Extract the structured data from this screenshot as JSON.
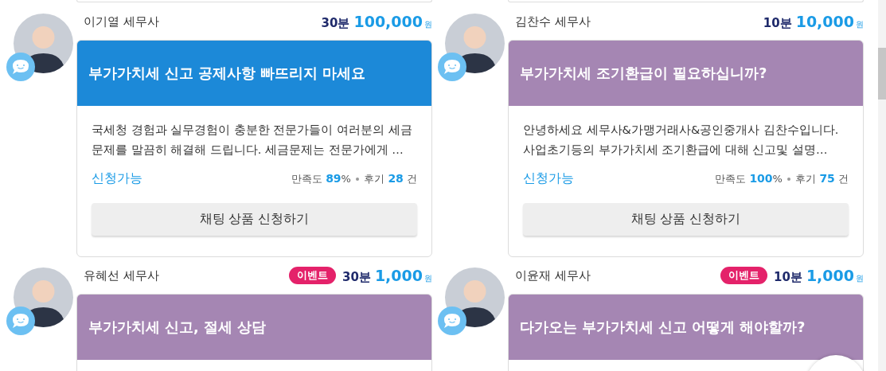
{
  "rows": [
    {
      "experts": [
        {
          "name": "이기열 세무사",
          "duration": "30분",
          "price": "100,000",
          "unit": "원",
          "color": "#1c89d8",
          "title": "부가가치세 신고 공제사항 빠뜨리지 마세요",
          "description": "국세청 경험과 실무경험이 충분한 전문가들이 여러분의 세금문제를 말끔히 해결해 드립니다.  세금문제는 전문가에게 …",
          "status": "신청가능",
          "satisfaction_label": "만족도",
          "satisfaction": "89",
          "percent": "%",
          "reviews_label": "후기",
          "reviews": "28",
          "reviews_unit": "건",
          "button": "채팅 상품 신청하기"
        },
        {
          "name": "김찬수 세무사",
          "duration": "10분",
          "price": "10,000",
          "unit": "원",
          "color": "#a586b3",
          "title": "부가가치세 조기환급이 필요하십니까?",
          "description": "안녕하세요 세무사&가맹거래사&공인중개사 김찬수입니다. 사업초기등의 부가가치세 조기환급에 대해 신고및 설명…",
          "status": "신청가능",
          "satisfaction_label": "만족도",
          "satisfaction": "100",
          "percent": "%",
          "reviews_label": "후기",
          "reviews": "75",
          "reviews_unit": "건",
          "button": "채팅 상품 신청하기"
        }
      ]
    },
    {
      "experts": [
        {
          "name": "유혜선 세무사",
          "badge": "이벤트",
          "duration": "30분",
          "price": "1,000",
          "unit": "원",
          "color": "#a586b3",
          "title": "부가가치세 신고, 절세 상담"
        },
        {
          "name": "이윤재 세무사",
          "badge": "이벤트",
          "duration": "10분",
          "price": "1,000",
          "unit": "원",
          "color": "#a586b3",
          "title": "다가오는 부가가치세 신고 어떻게 해야할까?"
        }
      ]
    }
  ]
}
